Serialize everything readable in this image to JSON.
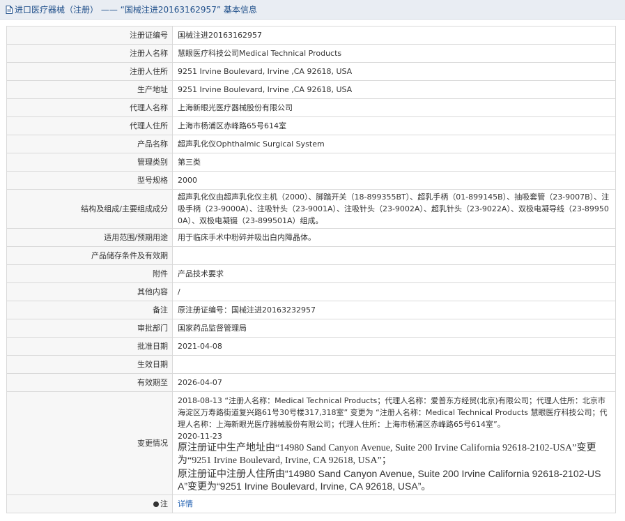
{
  "header": {
    "title": "进口医疗器械（注册） —— “国械注进20163162957” 基本信息"
  },
  "fields": [
    {
      "label": "注册证编号",
      "value": "国械注进20163162957"
    },
    {
      "label": "注册人名称",
      "value": "慧眼医疗科技公司Medical Technical Products"
    },
    {
      "label": "注册人住所",
      "value": "9251 Irvine Boulevard, Irvine ,CA 92618, USA"
    },
    {
      "label": "生产地址",
      "value": "9251 Irvine Boulevard, Irvine ,CA 92618, USA"
    },
    {
      "label": "代理人名称",
      "value": "上海新眼光医疗器械股份有限公司"
    },
    {
      "label": "代理人住所",
      "value": "上海市杨浦区赤峰路65号614室"
    },
    {
      "label": "产品名称",
      "value": "超声乳化仪Ophthalmic Surgical System"
    },
    {
      "label": "管理类别",
      "value": "第三类"
    },
    {
      "label": "型号规格",
      "value": "2000"
    },
    {
      "label": "结构及组成/主要组成成分",
      "value": "超声乳化仪由超声乳化仪主机（2000）、脚踏开关（18-899355BT）、超乳手柄（01-899145B）、抽吸套管（23-9007B）、注吸手柄（23-9000A）、注吸针头（23-9001A）、注吸针头（23-9002A）、超乳针头（23-9022A）、双极电凝导线（23-899500A）、双极电凝镊（23-899501A）组成。"
    },
    {
      "label": "适用范围/预期用途",
      "value": "用于临床手术中粉碎并吸出白内障晶体。"
    },
    {
      "label": "产品储存条件及有效期",
      "value": ""
    },
    {
      "label": "附件",
      "value": "产品技术要求"
    },
    {
      "label": "其他内容",
      "value": "/"
    },
    {
      "label": "备注",
      "value": "原注册证编号：国械注进20163232957"
    },
    {
      "label": "审批部门",
      "value": "国家药品监督管理局"
    },
    {
      "label": "批准日期",
      "value": "2021-04-08"
    },
    {
      "label": "生效日期",
      "value": ""
    },
    {
      "label": "有效期至",
      "value": "2026-04-07"
    }
  ],
  "changes": {
    "label": "变更情况",
    "line1": "2018-08-13 “注册人名称：Medical Technical Products；代理人名称：爱普东方经贸(北京)有限公司；代理人住所：北京市海淀区万寿路街道复兴路61号30号楼317,318室” 变更为 “注册人名称：Medical Technical Products 慧眼医疗科技公司；代理人名称：上海新眼光医疗器械股份有限公司；代理人住所：上海市杨浦区赤峰路65号614室”。",
    "line2": "2020-11-23",
    "line3": "原注册证中生产地址由“14980 Sand Canyon Avenue, Suite 200 Irvine California 92618-2102-USA”变更为“9251 Irvine Boulevard, Irvine, CA 92618, USA”；",
    "line4": "原注册证中注册人住所由“14980 Sand Canyon Avenue, Suite 200 Irvine California 92618-2102-USA”变更为“9251 Irvine Boulevard, Irvine, CA 92618, USA”。"
  },
  "note": {
    "label": "注",
    "link": "详情"
  },
  "icons": {
    "header": "document-icon",
    "note": "pin-icon"
  },
  "colors": {
    "header_bg": "#e9edf3",
    "header_text": "#1f4f8a",
    "label_bg": "#f7f7f7",
    "border": "#d9d9d9",
    "link": "#1f5fb0"
  }
}
